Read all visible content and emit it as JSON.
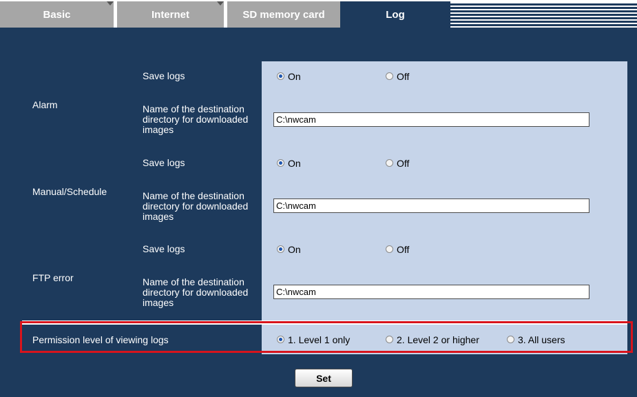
{
  "tabs": [
    {
      "label": "Basic",
      "active": false
    },
    {
      "label": "Internet",
      "active": false
    },
    {
      "label": "SD memory card",
      "active": false
    },
    {
      "label": "Log",
      "active": true
    }
  ],
  "log_settings": {
    "sections": [
      {
        "name": "Alarm",
        "save_logs_label": "Save logs",
        "save_logs_options": [
          "On",
          "Off"
        ],
        "save_logs_selected": "On",
        "dir_label": "Name of the destination directory for downloaded images",
        "dir_value": "C:\\nwcam"
      },
      {
        "name": "Manual/Schedule",
        "save_logs_label": "Save logs",
        "save_logs_options": [
          "On",
          "Off"
        ],
        "save_logs_selected": "On",
        "dir_label": "Name of the destination directory for downloaded images",
        "dir_value": "C:\\nwcam"
      },
      {
        "name": "FTP error",
        "save_logs_label": "Save logs",
        "save_logs_options": [
          "On",
          "Off"
        ],
        "save_logs_selected": "On",
        "dir_label": "Name of the destination directory for downloaded images",
        "dir_value": "C:\\nwcam"
      }
    ],
    "permission": {
      "label": "Permission level of viewing logs",
      "options": [
        "1. Level 1 only",
        "2. Level 2 or higher",
        "3. All users"
      ],
      "selected": "1. Level 1 only"
    }
  },
  "set_button_label": "Set",
  "colors": {
    "header_bg": "#1d3a5c",
    "value_bg": "#c6d4e9",
    "highlight_border": "#d8141c",
    "tab_inactive": "#a6a6a6"
  }
}
